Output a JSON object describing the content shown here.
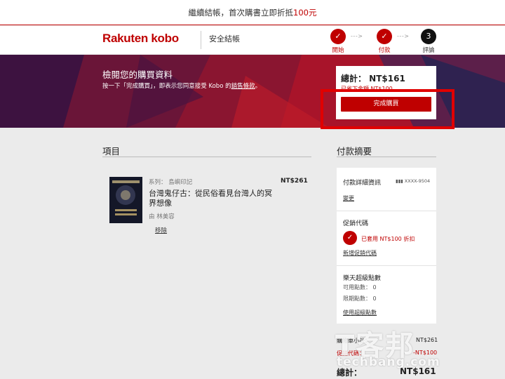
{
  "promo": {
    "text": "繼續結帳，首次購書立即折抵",
    "amount": "100元"
  },
  "header": {
    "logo": "Rakuten kobo",
    "secure_checkout": "安全結帳",
    "steps": [
      {
        "label": "開始",
        "marker": "✓"
      },
      {
        "label": "付款",
        "marker": "✓"
      },
      {
        "label": "評論",
        "marker": "3"
      }
    ]
  },
  "banner": {
    "title": "檢閱您的購買資料",
    "subtitle_pre": "按一下「完成購買」，即表示您同意接受 Kobo 的",
    "subtitle_link": "銷售條款",
    "subtitle_post": "。"
  },
  "summary": {
    "total": "總計： NT$161",
    "saved": "已省下金額 NT$100",
    "complete_button": "完成購買"
  },
  "items_section": {
    "title": "項目",
    "items": [
      {
        "series": "系列： 島嶼印記",
        "price": "NT$261",
        "title": "台灣鬼仔古：從民俗看見台灣人的冥界想像",
        "author": "由 林美容",
        "remove": "移除"
      }
    ]
  },
  "payment_section": {
    "title": "付款摘要",
    "details_label": "付款詳細資訊",
    "card_masked": "XXXX-9504",
    "change_link": "變更",
    "promo_label": "促銷代碼",
    "promo_applied": "已套用 NT$100 折扣",
    "add_promo_link": "新增促銷代碼",
    "points_label": "樂天超級點數",
    "available_points_label": "可用點數：",
    "available_points": "0",
    "expiring_points_label": "限期點數：",
    "expiring_points": "0",
    "use_points_link": "使用超級點數",
    "subtotal_label": "購物車小計：",
    "subtotal": "NT$261",
    "discount_label": "促銷代碼：",
    "discount": "-NT$100",
    "grand_total_label": "總計：",
    "grand_total": "NT$161"
  },
  "watermark": {
    "big": "T客邦",
    "small": "techbang.com"
  },
  "colors": {
    "accent": "#bf0000",
    "highlight": "#e00000",
    "page_bg": "#ebebeb"
  }
}
